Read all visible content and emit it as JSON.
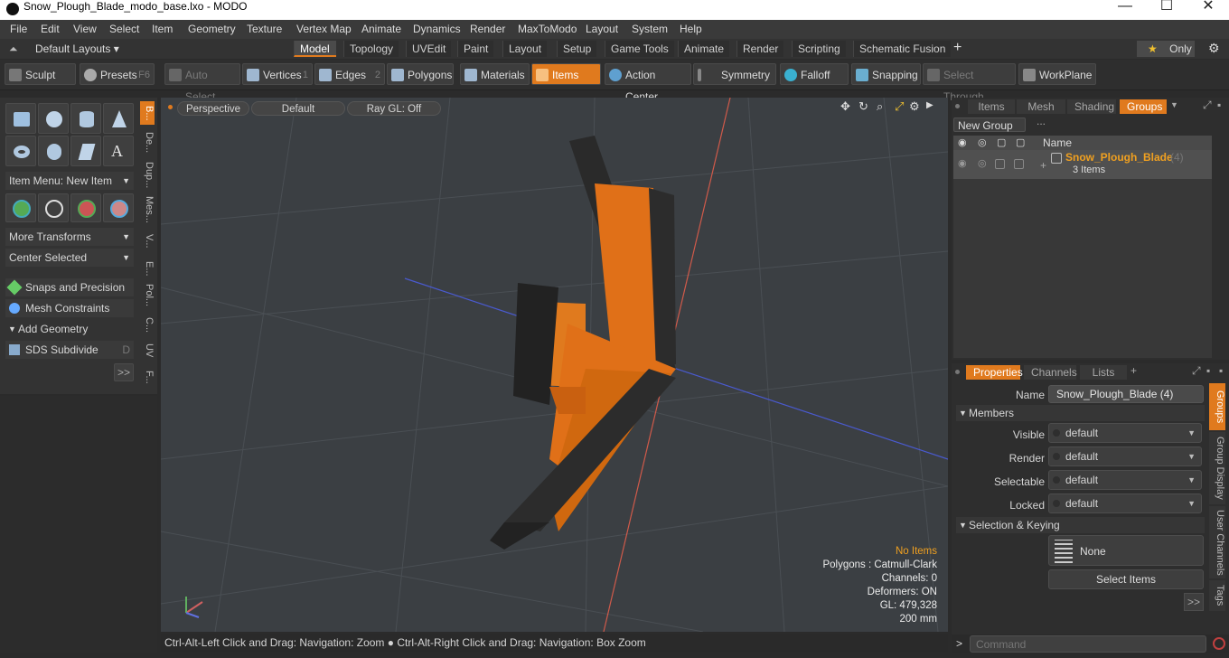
{
  "window": {
    "title": "Snow_Plough_Blade_modo_base.lxo - MODO",
    "minimize": "—",
    "maximize": "☐",
    "close": "✕"
  },
  "menu": [
    "File",
    "Edit",
    "View",
    "Select",
    "Item",
    "Geometry",
    "Texture",
    "Vertex Map",
    "Animate",
    "Dynamics",
    "Render",
    "MaxToModo",
    "Layout",
    "System",
    "Help"
  ],
  "layouts": {
    "label": "Default Layouts ▾",
    "tabs": [
      "Model",
      "Topology",
      "UVEdit",
      "Paint",
      "Layout",
      "Setup",
      "Game Tools",
      "Animate",
      "Render",
      "Scripting",
      "Schematic Fusion"
    ],
    "add": "+",
    "only": "Only",
    "star": "★"
  },
  "toolbar": {
    "sculpt": "Sculpt",
    "presets": "Presets",
    "presets_key": "F6",
    "auto_select": "Auto Select",
    "vertices": "Vertices",
    "vertices_key": "1",
    "edges": "Edges",
    "edges_key": "2",
    "polygons": "Polygons",
    "materials": "Materials",
    "items": "Items",
    "action_center": "Action Center",
    "symmetry": "Symmetry",
    "falloff": "Falloff",
    "snapping": "Snapping",
    "select_through": "Select Through",
    "workplane": "WorkPlane"
  },
  "left": {
    "item_menu": "Item Menu: New Item",
    "more_transforms": "More Transforms",
    "center_selected": "Center Selected",
    "snaps": "Snaps and Precision",
    "mesh_constraints": "Mesh Constraints",
    "add_geometry": "Add Geometry",
    "sds": "SDS Subdivide",
    "sds_key": "D",
    "more": ">>",
    "vtabs": [
      "B...",
      "De...",
      "Dup...",
      "Mes...",
      "V...",
      "E...",
      "Pol...",
      "C...",
      "UV",
      "F..."
    ]
  },
  "viewport": {
    "view": "Perspective",
    "shading": "Default",
    "ray": "Ray GL: Off",
    "info": {
      "no_items": "No Items",
      "polygons": "Polygons : Catmull-Clark",
      "channels": "Channels: 0",
      "deformers": "Deformers: ON",
      "gl": "GL: 479,328",
      "scale": "200 mm"
    }
  },
  "status": "Ctrl-Alt-Left Click and Drag: Navigation: Zoom ● Ctrl-Alt-Right Click and Drag: Navigation: Box Zoom",
  "groups_panel": {
    "tabs": [
      "Items",
      "Mesh ...",
      "Shading",
      "Groups"
    ],
    "new_group": "New Group",
    "col_name": "Name",
    "group_name": "Snow_Plough_Blade",
    "group_count": "(4)",
    "group_items": "3 Items"
  },
  "props_panel": {
    "tabs": [
      "Properties",
      "Channels",
      "Lists"
    ],
    "name_label": "Name",
    "name_value": "Snow_Plough_Blade (4)",
    "members": "Members",
    "visible_label": "Visible",
    "visible": "default",
    "render_label": "Render",
    "render": "default",
    "selectable_label": "Selectable",
    "selectable": "default",
    "locked_label": "Locked",
    "locked": "default",
    "sel_keying": "Selection & Keying",
    "none": "None",
    "select_items": "Select Items",
    "more": ">>",
    "vtabs": [
      "Groups",
      "Group Display",
      "User Channels",
      "Tags"
    ]
  },
  "command": {
    "prompt": ">",
    "placeholder": "Command"
  },
  "colors": {
    "accent": "#e07a1e",
    "selected_text": "#f0a020"
  }
}
